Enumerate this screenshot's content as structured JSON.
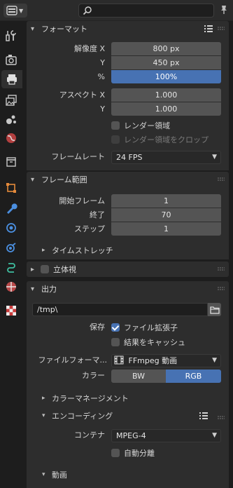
{
  "header": {
    "editor_type_icon": "properties-icon",
    "search_placeholder": ""
  },
  "tabs": [
    {
      "name": "tool-tab-icon",
      "icon": "tool-icon"
    },
    {
      "name": "render-tab-icon",
      "icon": "render-icon"
    },
    {
      "name": "output-tab-icon",
      "icon": "printer-icon",
      "active": true
    },
    {
      "name": "view-layer-tab-icon",
      "icon": "view-layer-icon"
    },
    {
      "name": "scene-tab-icon",
      "icon": "scene-icon"
    },
    {
      "name": "world-tab-icon",
      "icon": "world-icon"
    },
    {
      "name": "collection-tab-icon",
      "icon": "collection-icon"
    },
    {
      "name": "object-tab-icon",
      "icon": "object-icon"
    },
    {
      "name": "modifier-tab-icon",
      "icon": "wrench-icon"
    },
    {
      "name": "particles-tab-icon",
      "icon": "particles-icon"
    },
    {
      "name": "physics-tab-icon",
      "icon": "physics-icon"
    },
    {
      "name": "constraints-tab-icon",
      "icon": "constraint-icon"
    },
    {
      "name": "data-tab-icon",
      "icon": "data-icon"
    },
    {
      "name": "texture-tab-icon",
      "icon": "texture-icon"
    }
  ],
  "format": {
    "title": "フォーマット",
    "res_x_label": "解像度 X",
    "res_x": "800 px",
    "res_y_label": "Y",
    "res_y": "450 px",
    "pct_label": "%",
    "pct": "100%",
    "aspect_x_label": "アスペクト X",
    "aspect_x": "1.000",
    "aspect_y_label": "Y",
    "aspect_y": "1.000",
    "render_region": "レンダー領域",
    "crop_region": "レンダー領域をクロップ",
    "framerate_label": "フレームレート",
    "framerate": "24 FPS"
  },
  "frame_range": {
    "title": "フレーム範囲",
    "start_label": "開始フレーム",
    "start": "1",
    "end_label": "終了",
    "end": "70",
    "step_label": "ステップ",
    "step": "1",
    "time_stretch": "タイムストレッチ"
  },
  "stereo": {
    "title": "立体視"
  },
  "output": {
    "title": "出力",
    "path": "/tmp\\",
    "save_label": "保存",
    "file_ext": "ファイル拡張子",
    "cache_result": "結果をキャッシュ",
    "file_format_label": "ファイルフォーマ...",
    "file_format": "FFmpeg 動画",
    "color_label": "カラー",
    "color_bw": "BW",
    "color_rgb": "RGB",
    "color_management": "カラーマネージメント",
    "encoding": "エンコーディング",
    "container_label": "コンテナ",
    "container": "MPEG-4",
    "autosplit": "自動分離",
    "video": "動画"
  },
  "colors": {
    "accent": "#4772b3",
    "field": "#545454",
    "panel": "#2d2d2d"
  }
}
